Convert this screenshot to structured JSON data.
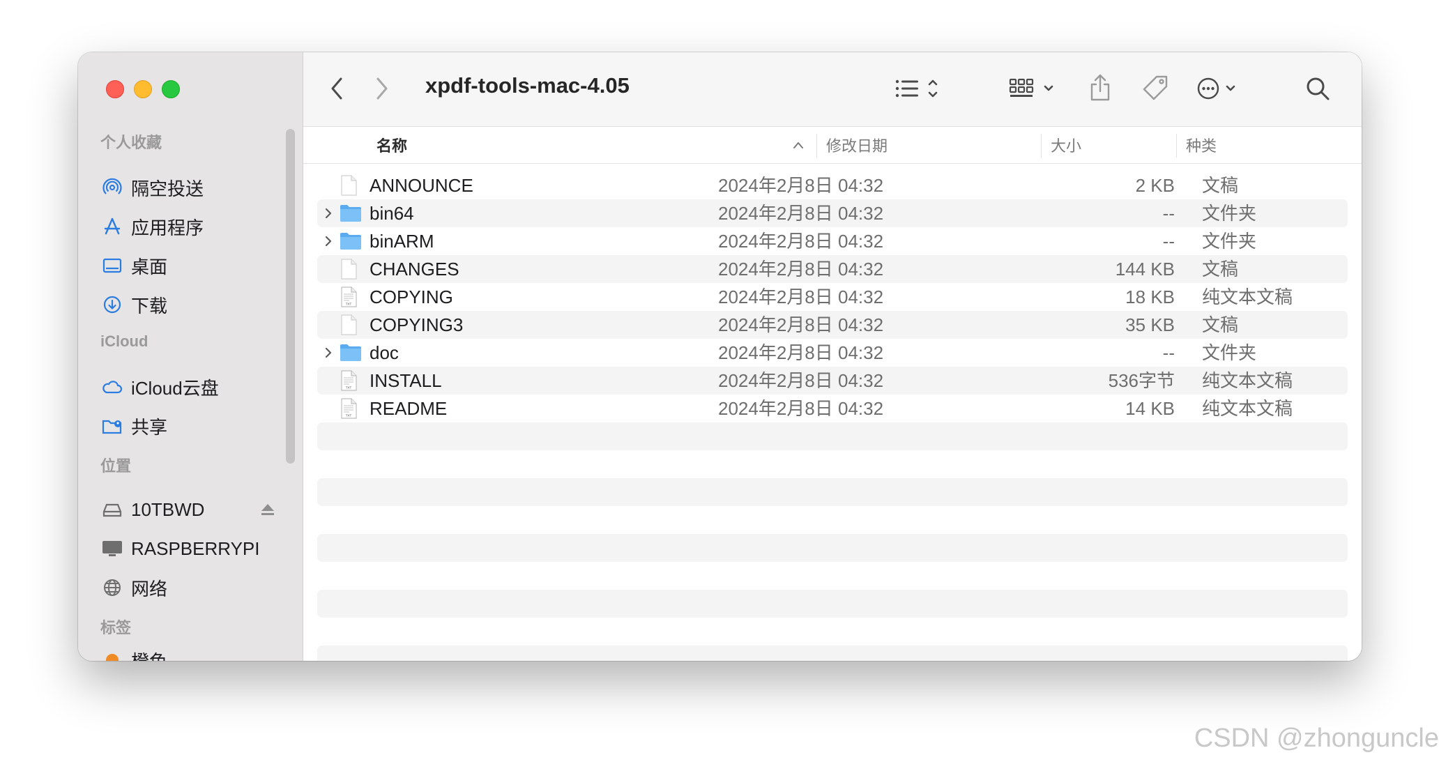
{
  "window": {
    "title": "xpdf-tools-mac-4.05"
  },
  "sidebar": {
    "favorites_title": "个人收藏",
    "favorites": [
      {
        "label": "隔空投送",
        "icon": "airdrop-icon"
      },
      {
        "label": "应用程序",
        "icon": "applications-icon"
      },
      {
        "label": "桌面",
        "icon": "desktop-icon"
      },
      {
        "label": "下载",
        "icon": "downloads-icon"
      }
    ],
    "icloud_title": "iCloud",
    "icloud": [
      {
        "label": "iCloud云盘",
        "icon": "cloud-icon"
      },
      {
        "label": "共享",
        "icon": "shared-folder-icon"
      }
    ],
    "locations_title": "位置",
    "locations": [
      {
        "label": "10TBWD",
        "icon": "drive-icon"
      },
      {
        "label": "RASPBERRYPI",
        "icon": "monitor-icon"
      },
      {
        "label": "网络",
        "icon": "globe-icon"
      }
    ],
    "tags_title": "标签",
    "tags": [
      {
        "label": "橙色",
        "color": "#f08a24"
      }
    ]
  },
  "columns": {
    "name": "名称",
    "date": "修改日期",
    "size": "大小",
    "kind": "种类"
  },
  "files": [
    {
      "name": "ANNOUNCE",
      "date": "2024年2月8日 04:32",
      "size": "2 KB",
      "kind": "文稿",
      "type": "doc"
    },
    {
      "name": "bin64",
      "date": "2024年2月8日 04:32",
      "size": "--",
      "kind": "文件夹",
      "type": "folder"
    },
    {
      "name": "binARM",
      "date": "2024年2月8日 04:32",
      "size": "--",
      "kind": "文件夹",
      "type": "folder"
    },
    {
      "name": "CHANGES",
      "date": "2024年2月8日 04:32",
      "size": "144 KB",
      "kind": "文稿",
      "type": "doc"
    },
    {
      "name": "COPYING",
      "date": "2024年2月8日 04:32",
      "size": "18 KB",
      "kind": "纯文本文稿",
      "type": "txt"
    },
    {
      "name": "COPYING3",
      "date": "2024年2月8日 04:32",
      "size": "35 KB",
      "kind": "文稿",
      "type": "doc"
    },
    {
      "name": "doc",
      "date": "2024年2月8日 04:32",
      "size": "--",
      "kind": "文件夹",
      "type": "folder"
    },
    {
      "name": "INSTALL",
      "date": "2024年2月8日 04:32",
      "size": "536字节",
      "kind": "纯文本文稿",
      "type": "txt"
    },
    {
      "name": "README",
      "date": "2024年2月8日 04:32",
      "size": "14 KB",
      "kind": "纯文本文稿",
      "type": "txt"
    }
  ],
  "watermark": "CSDN @zhonguncle",
  "colors": {
    "accent": "#2a7ce0",
    "folder": "#5aabf0"
  }
}
